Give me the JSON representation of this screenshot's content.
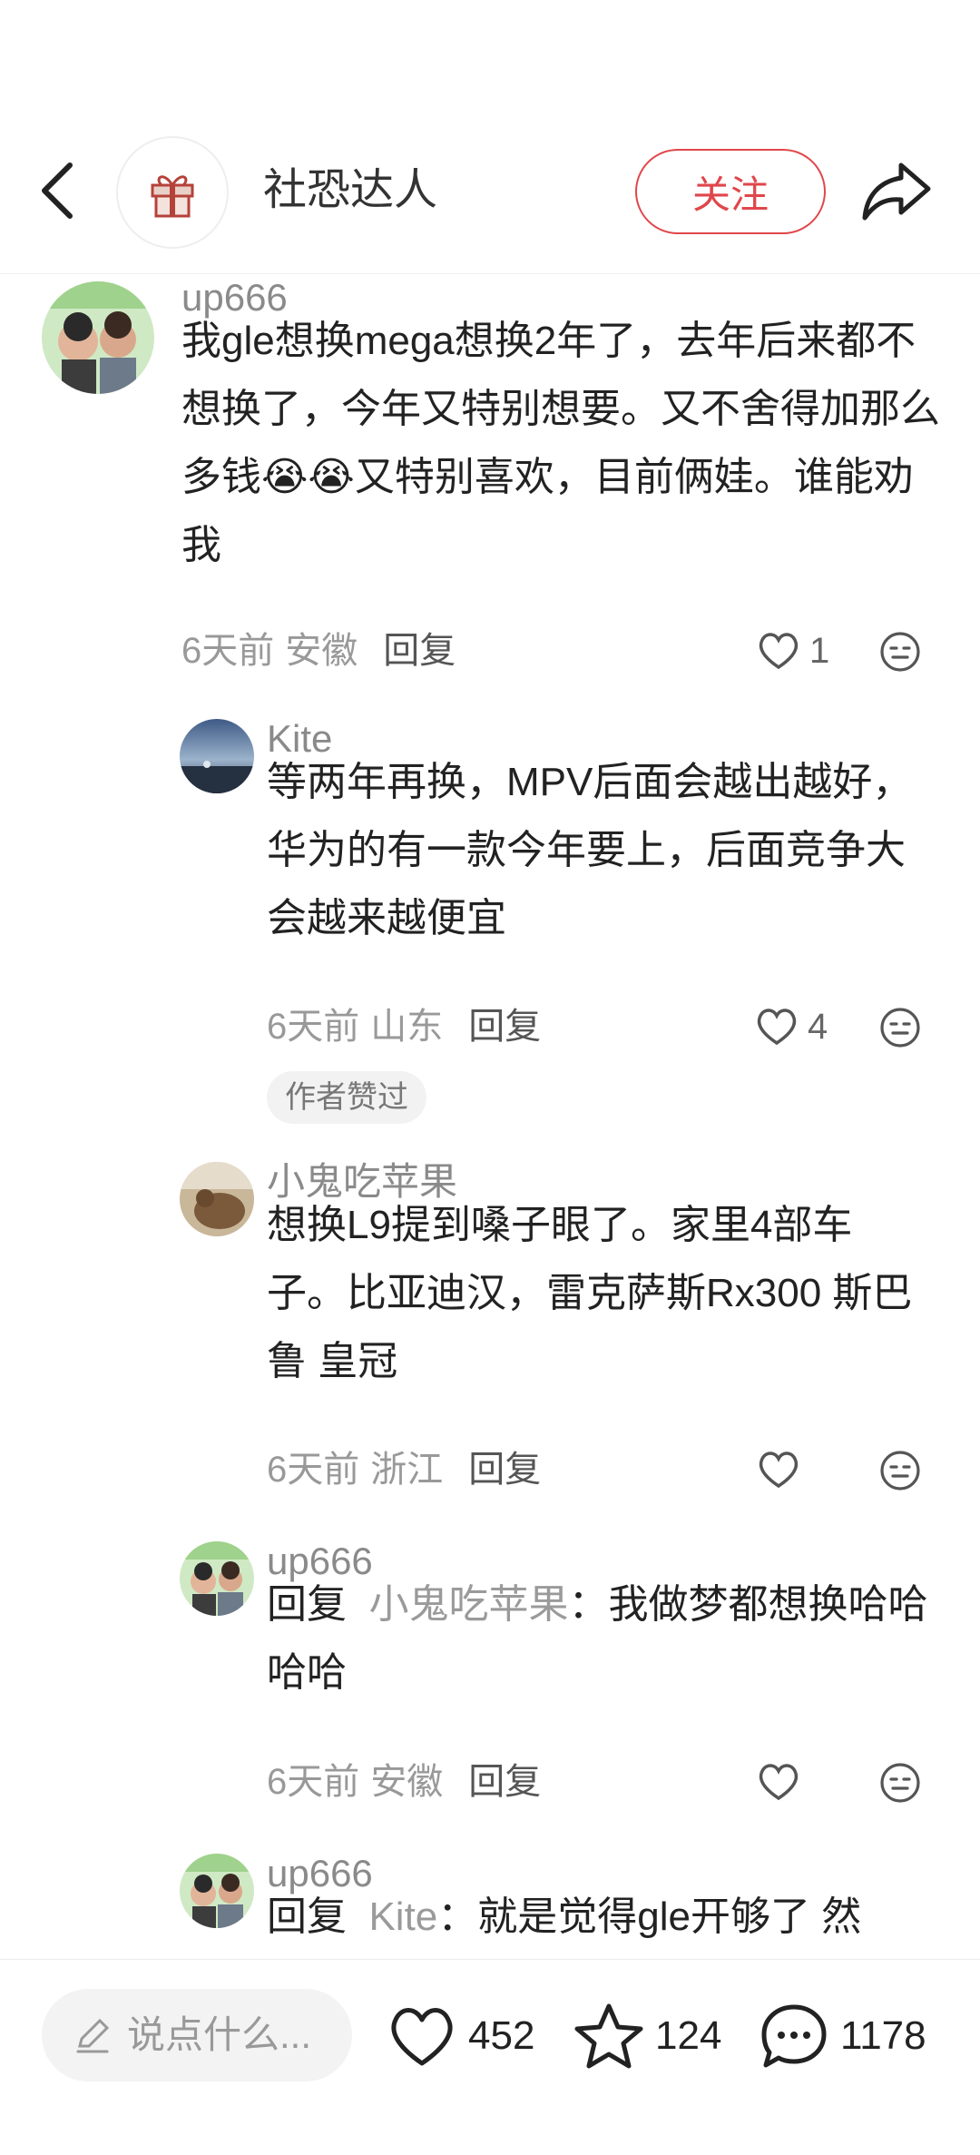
{
  "header": {
    "title": "社恐达人",
    "follow_label": "关注"
  },
  "comments": [
    {
      "user": "up666",
      "text": "我gle想换mega想换2年了，去年后来都不想换了，今年又特别想要。又不舍得加那么多钱😭😭又特别喜欢，目前俩娃。谁能劝我",
      "time": "6天前",
      "location": "安徽",
      "reply_label": "回复",
      "likes": "1"
    },
    {
      "user": "Kite",
      "text": "等两年再换，MPV后面会越出越好，华为的有一款今年要上，后面竞争大会越来越便宜",
      "time": "6天前",
      "location": "山东",
      "reply_label": "回复",
      "likes": "4",
      "badge": "作者赞过"
    },
    {
      "user": "小鬼吃苹果",
      "text": "想换L9提到嗓子眼了。家里4部车子。比亚迪汉，雷克萨斯Rx300 斯巴鲁 皇冠",
      "time": "6天前",
      "location": "浙江",
      "reply_label": "回复",
      "likes": ""
    },
    {
      "user": "up666",
      "reply_prefix": "回复",
      "reply_to": "小鬼吃苹果",
      "text": "：我做梦都想换哈哈哈哈",
      "time": "6天前",
      "location": "安徽",
      "reply_label": "回复",
      "likes": ""
    },
    {
      "user": "up666",
      "reply_prefix": "回复",
      "reply_to": "Kite",
      "text": "：就是觉得gle开够了 然"
    }
  ],
  "bottom_bar": {
    "input_placeholder": "说点什么...",
    "likes": "452",
    "favorites": "124",
    "comments": "1178"
  },
  "colors": {
    "accent": "#e0464b",
    "muted_text": "#999999",
    "body_text": "#222222"
  },
  "icons": [
    "back-arrow-icon",
    "gift-icon",
    "share-icon",
    "heart-icon",
    "emoji-icon",
    "pen-icon",
    "star-icon",
    "comment-bubble-icon"
  ]
}
